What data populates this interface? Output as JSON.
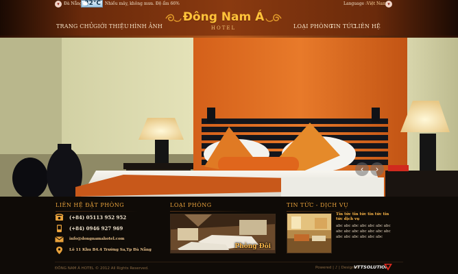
{
  "topbar": {
    "city": "Đà Nẵng",
    "temperature": "32°C",
    "condition": "Nhiều mây, không mưa. Độ ẩm 66%",
    "language_label": "Language :",
    "language_value": "Việt Nam"
  },
  "nav": {
    "home": "TRANG CHỦ",
    "about": "GIỚI THIỆU",
    "gallery": "HÌNH ẢNH",
    "rooms": "LOẠI PHÒNG",
    "news": "TIN TỨC",
    "contact": "LIÊN HỆ"
  },
  "logo": {
    "name": "Đông Nam Á",
    "subtitle": "HOTEL"
  },
  "slider": {
    "prev_icon": "chevron-left-icon",
    "next_icon": "chevron-right-icon"
  },
  "booking": {
    "title": "LIÊN HỆ ĐẶT PHÒNG",
    "phone": "(+84) 05113 952 952",
    "mobile": "(+84) 0946 927 969",
    "email": "info@dongnamahotel.com",
    "address": "Lô 11 Khu B4.4 Trường Sa,Tp Đà Nẵng"
  },
  "rooms": {
    "title": "LOẠI PHÒNG",
    "caption": "Phòng Đôi"
  },
  "news": {
    "title": "TIN TỨC - DỊCH VỤ",
    "item_title": "Tin tức tin tức tin tức tin tức dịch vụ",
    "item_body": "abc abc abc abc abc abc abc abc abc abc abc abc abc abc abc abc abc abc abc abc"
  },
  "footer": {
    "copyright": "ĐÔNG NAM Á HOTEL © 2012 All Rights Reserved.",
    "powered": "Powered | ♪ | Designed",
    "designer": "VTTSOLUTION"
  },
  "colors": {
    "accent": "#e8a23c",
    "header": "#8a3a10",
    "background": "#0f0b07"
  }
}
